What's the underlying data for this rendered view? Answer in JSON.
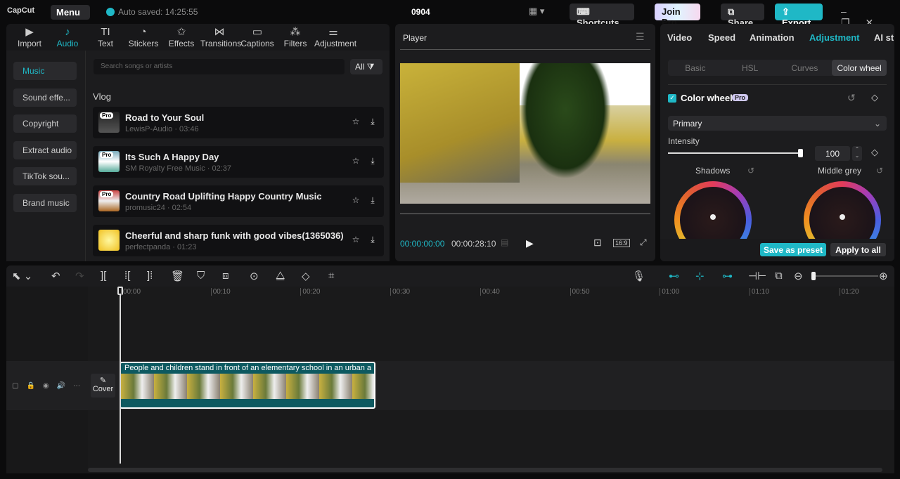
{
  "titlebar": {
    "logo": "CapCut",
    "menu": "Menu",
    "autosave": "Auto saved: 14:25:55",
    "project": "0904",
    "shortcuts": "Shortcuts",
    "join_pro": "Join Pro",
    "share": "Share",
    "export": "Export"
  },
  "media_tabs": [
    {
      "label": "Import",
      "icon": "▶"
    },
    {
      "label": "Audio",
      "icon": "♪"
    },
    {
      "label": "Text",
      "icon": "TI"
    },
    {
      "label": "Stickers",
      "icon": "◔"
    },
    {
      "label": "Effects",
      "icon": "✩"
    },
    {
      "label": "Transitions",
      "icon": "⋈"
    },
    {
      "label": "Captions",
      "icon": "▭"
    },
    {
      "label": "Filters",
      "icon": "⁂"
    },
    {
      "label": "Adjustment",
      "icon": "⚌"
    }
  ],
  "categories": [
    "Music",
    "Sound effe...",
    "Copyright",
    "Extract audio",
    "TikTok sou...",
    "Brand music"
  ],
  "search_placeholder": "Search songs or artists",
  "filter_all": "All",
  "section": "Vlog",
  "pro_badge": "Pro",
  "songs": [
    {
      "title": "Road to Your Soul",
      "sub": "LewisP-Audio · 03:46",
      "pro": true
    },
    {
      "title": "Its Such A Happy Day",
      "sub": "SM Royalty Free Music · 02:37",
      "pro": true
    },
    {
      "title": "Country Road Uplifting Happy Country Music",
      "sub": "promusic24 · 02:54",
      "pro": true
    },
    {
      "title": "Cheerful and sharp funk with good vibes(1365036)",
      "sub": "perfectpanda · 01:23",
      "pro": false
    }
  ],
  "player": {
    "title": "Player",
    "current": "00:00:00:00",
    "total": "00:00:28:10",
    "ratio": "16:9"
  },
  "right": {
    "tabs": [
      "Video",
      "Speed",
      "Animation",
      "Adjustment",
      "AI st"
    ],
    "subtabs": [
      "Basic",
      "HSL",
      "Curves",
      "Color wheel"
    ],
    "section": "Color wheel",
    "mode": "Primary",
    "intensity_label": "Intensity",
    "intensity": "100",
    "intensity_fraction": 1.0,
    "wheel1": "Shadows",
    "wheel2": "Middle grey",
    "save_preset": "Save as preset",
    "apply_all": "Apply to all"
  },
  "timeline": {
    "ticks": [
      "00:00",
      "00:10",
      "00:20",
      "00:30",
      "00:40",
      "00:50",
      "01:00",
      "01:10",
      "01:20"
    ],
    "clip_title": "People and children stand in front of an elementary school in an urban a",
    "cover": "Cover"
  },
  "colors": {
    "accent": "#1fb8c6",
    "clip": "#0d5960"
  }
}
